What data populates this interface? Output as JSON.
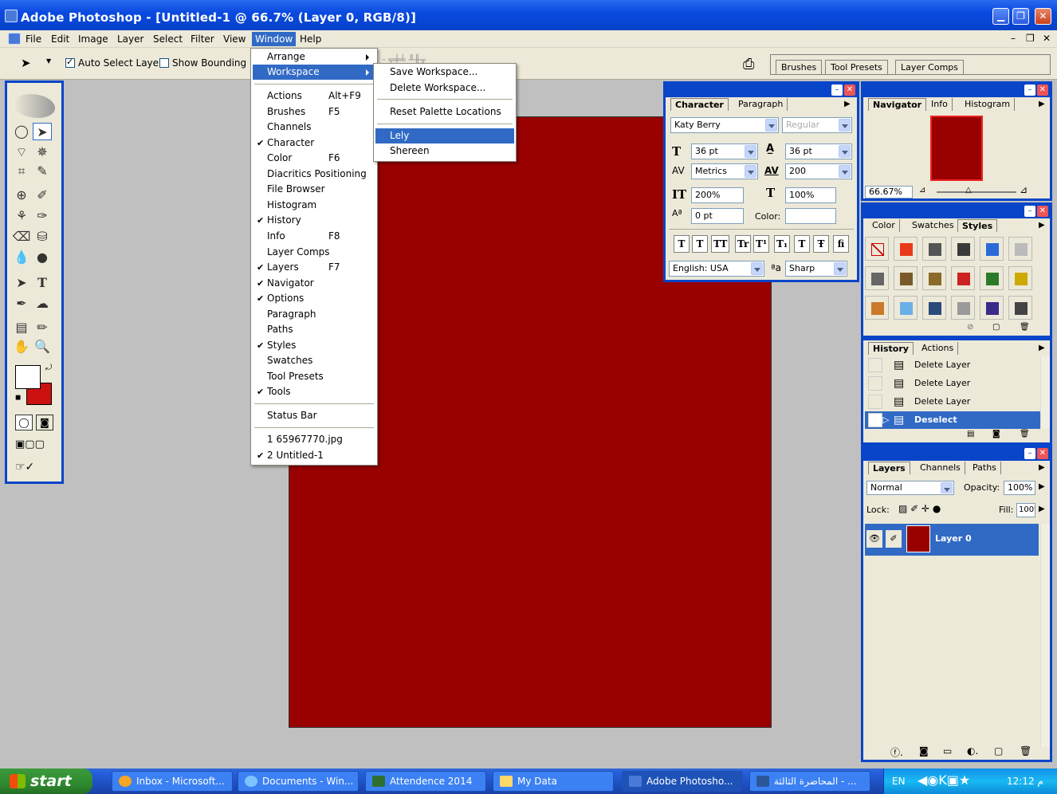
{
  "app": {
    "title": "Adobe Photoshop - [Untitled-1 @ 66.7% (Layer 0, RGB/8)]"
  },
  "menubar": {
    "items": [
      "File",
      "Edit",
      "Image",
      "Layer",
      "Select",
      "Filter",
      "View",
      "Window",
      "Help"
    ],
    "active": "Window"
  },
  "options": {
    "auto_select": "Auto Select Layer",
    "show_bounding": "Show Bounding Bo",
    "well_tabs": [
      "Brushes",
      "Tool Presets",
      "Layer Comps"
    ]
  },
  "window_menu": {
    "arrange": "Arrange",
    "workspace": "Workspace",
    "items": [
      {
        "label": "Actions",
        "accel": "Alt+F9",
        "checked": false
      },
      {
        "label": "Brushes",
        "accel": "F5",
        "checked": false
      },
      {
        "label": "Channels",
        "accel": "",
        "checked": false
      },
      {
        "label": "Character",
        "accel": "",
        "checked": true
      },
      {
        "label": "Color",
        "accel": "F6",
        "checked": false
      },
      {
        "label": "Diacritics Positioning",
        "accel": "",
        "checked": false
      },
      {
        "label": "File Browser",
        "accel": "",
        "checked": false
      },
      {
        "label": "Histogram",
        "accel": "",
        "checked": false
      },
      {
        "label": "History",
        "accel": "",
        "checked": true
      },
      {
        "label": "Info",
        "accel": "F8",
        "checked": false
      },
      {
        "label": "Layer Comps",
        "accel": "",
        "checked": false
      },
      {
        "label": "Layers",
        "accel": "F7",
        "checked": true
      },
      {
        "label": "Navigator",
        "accel": "",
        "checked": true
      },
      {
        "label": "Options",
        "accel": "",
        "checked": true
      },
      {
        "label": "Paragraph",
        "accel": "",
        "checked": false
      },
      {
        "label": "Paths",
        "accel": "",
        "checked": false
      },
      {
        "label": "Styles",
        "accel": "",
        "checked": true
      },
      {
        "label": "Swatches",
        "accel": "",
        "checked": false
      },
      {
        "label": "Tool Presets",
        "accel": "",
        "checked": false
      },
      {
        "label": "Tools",
        "accel": "",
        "checked": true
      }
    ],
    "status_bar": "Status Bar",
    "docs": [
      {
        "label": "1 65967770.jpg",
        "checked": false
      },
      {
        "label": "2 Untitled-1",
        "checked": true
      }
    ]
  },
  "workspace_menu": {
    "save": "Save Workspace...",
    "delete": "Delete Workspace...",
    "reset": "Reset Palette Locations",
    "presets": [
      "Lely",
      "Shereen"
    ],
    "highlighted": "Lely"
  },
  "character": {
    "tabs": [
      "Character",
      "Paragraph"
    ],
    "font": "Katy Berry",
    "style": "Regular",
    "size": "36 pt",
    "leading": "36 pt",
    "kerning": "Metrics",
    "tracking": "200",
    "vscale": "200%",
    "hscale": "100%",
    "baseline": "0 pt",
    "color_label": "Color:",
    "style_buttons": [
      "T",
      "T",
      "TT",
      "Tr",
      "T¹",
      "T₁",
      "T",
      "Ŧ",
      "ﬁ"
    ],
    "language": "English: USA",
    "aa_label": "a",
    "antialias": "Sharp"
  },
  "navigator": {
    "tabs": [
      "Navigator",
      "Info",
      "Histogram"
    ],
    "zoom": "66.67%"
  },
  "styles": {
    "tabs": [
      "Color",
      "Swatches",
      "Styles"
    ]
  },
  "history": {
    "tabs": [
      "History",
      "Actions"
    ],
    "items": [
      "Delete Layer",
      "Delete Layer",
      "Delete Layer",
      "Deselect"
    ]
  },
  "layers": {
    "tabs": [
      "Layers",
      "Channels",
      "Paths"
    ],
    "blend": "Normal",
    "opacity_label": "Opacity:",
    "opacity": "100%",
    "lock_label": "Lock:",
    "fill_label": "Fill:",
    "fill": "100%",
    "layer_name": "Layer 0"
  },
  "taskbar": {
    "start": "start",
    "tasks": [
      "Inbox - Microsoft...",
      "Documents - Win...",
      "Attendence 2014",
      "My Data",
      "Adobe Photosho...",
      "المحاضرة الثالثة - ..."
    ],
    "lang": "EN",
    "clock": "12:12 م"
  },
  "colors": {
    "canvas": "#990000",
    "foreground": "#ffffff",
    "background": "#cc1111",
    "highlight": "#316ac5"
  }
}
